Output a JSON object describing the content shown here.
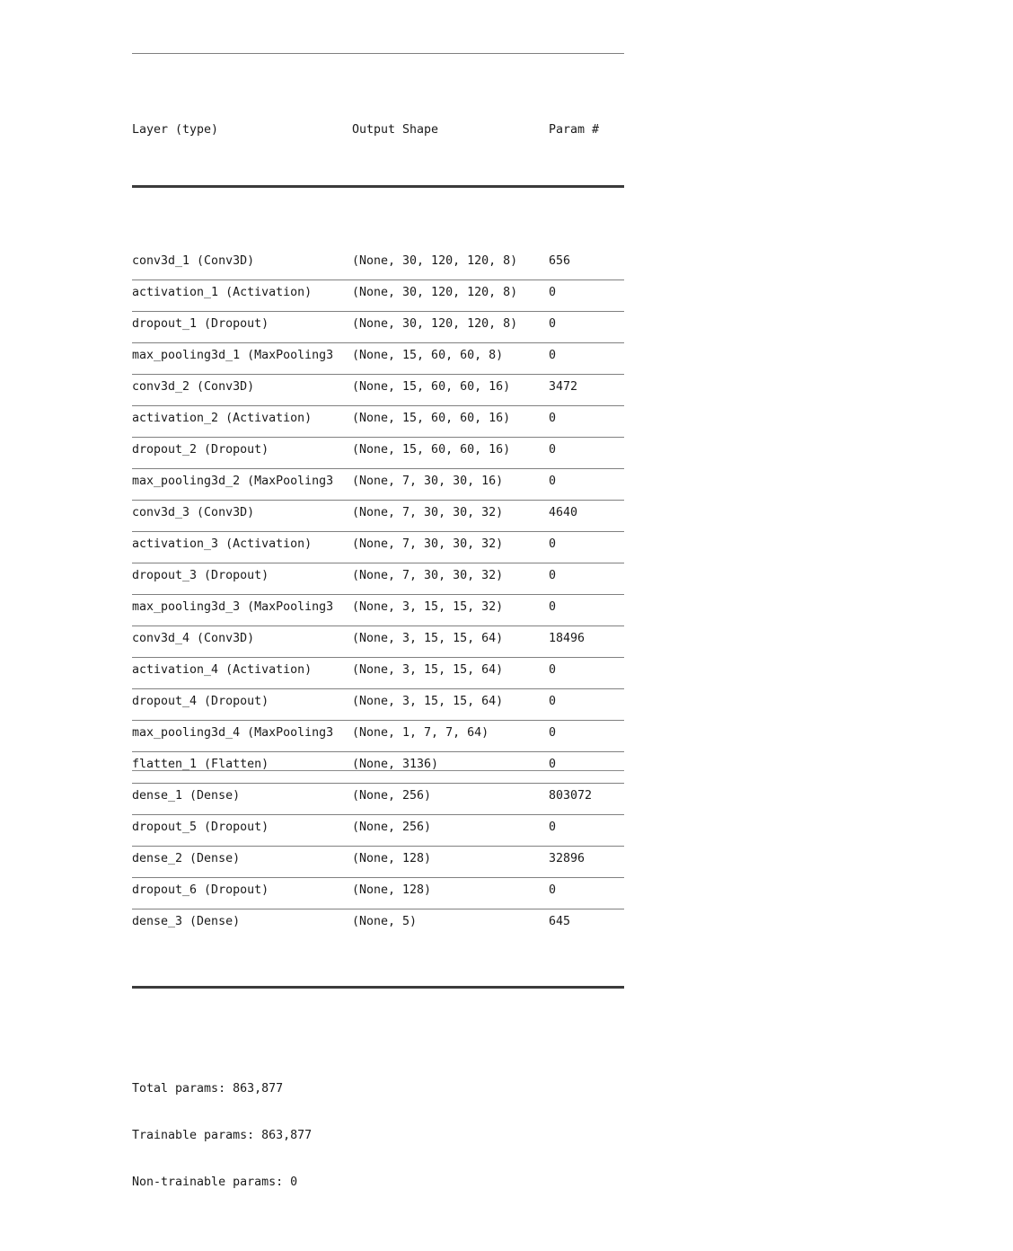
{
  "summary": {
    "columns": {
      "layer": "Layer (type)",
      "output_shape": "Output Shape",
      "param": "Param #"
    },
    "separator_double": "=================================================================",
    "separator_thin": "_________________________________________________________________",
    "rows": [
      {
        "layer": "conv3d_1 (Conv3D)",
        "shape": "(None, 30, 120, 120, 8)",
        "param": "656"
      },
      {
        "layer": "activation_1 (Activation)",
        "shape": "(None, 30, 120, 120, 8)",
        "param": "0"
      },
      {
        "layer": "dropout_1 (Dropout)",
        "shape": "(None, 30, 120, 120, 8)",
        "param": "0"
      },
      {
        "layer": "max_pooling3d_1 (MaxPooling3",
        "shape": "(None, 15, 60, 60, 8)",
        "param": "0"
      },
      {
        "layer": "conv3d_2 (Conv3D)",
        "shape": "(None, 15, 60, 60, 16)",
        "param": "3472"
      },
      {
        "layer": "activation_2 (Activation)",
        "shape": "(None, 15, 60, 60, 16)",
        "param": "0"
      },
      {
        "layer": "dropout_2 (Dropout)",
        "shape": "(None, 15, 60, 60, 16)",
        "param": "0"
      },
      {
        "layer": "max_pooling3d_2 (MaxPooling3",
        "shape": "(None, 7, 30, 30, 16)",
        "param": "0"
      },
      {
        "layer": "conv3d_3 (Conv3D)",
        "shape": "(None, 7, 30, 30, 32)",
        "param": "4640"
      },
      {
        "layer": "activation_3 (Activation)",
        "shape": "(None, 7, 30, 30, 32)",
        "param": "0"
      },
      {
        "layer": "dropout_3 (Dropout)",
        "shape": "(None, 7, 30, 30, 32)",
        "param": "0"
      },
      {
        "layer": "max_pooling3d_3 (MaxPooling3",
        "shape": "(None, 3, 15, 15, 32)",
        "param": "0"
      },
      {
        "layer": "conv3d_4 (Conv3D)",
        "shape": "(None, 3, 15, 15, 64)",
        "param": "18496"
      },
      {
        "layer": "activation_4 (Activation)",
        "shape": "(None, 3, 15, 15, 64)",
        "param": "0"
      },
      {
        "layer": "dropout_4 (Dropout)",
        "shape": "(None, 3, 15, 15, 64)",
        "param": "0"
      },
      {
        "layer": "max_pooling3d_4 (MaxPooling3",
        "shape": "(None, 1, 7, 7, 64)",
        "param": "0"
      },
      {
        "layer": "flatten_1 (Flatten)",
        "shape": "(None, 3136)",
        "param": "0"
      },
      {
        "layer": "dense_1 (Dense)",
        "shape": "(None, 256)",
        "param": "803072"
      },
      {
        "layer": "dropout_5 (Dropout)",
        "shape": "(None, 256)",
        "param": "0"
      },
      {
        "layer": "dense_2 (Dense)",
        "shape": "(None, 128)",
        "param": "32896"
      },
      {
        "layer": "dropout_6 (Dropout)",
        "shape": "(None, 128)",
        "param": "0"
      },
      {
        "layer": "dense_3 (Dense)",
        "shape": "(None, 5)",
        "param": "645"
      }
    ],
    "totals": {
      "total_params": "Total params: 863,877",
      "trainable_params": "Trainable params: 863,877",
      "non_trainable_params": "Non-trainable params: 0"
    }
  }
}
